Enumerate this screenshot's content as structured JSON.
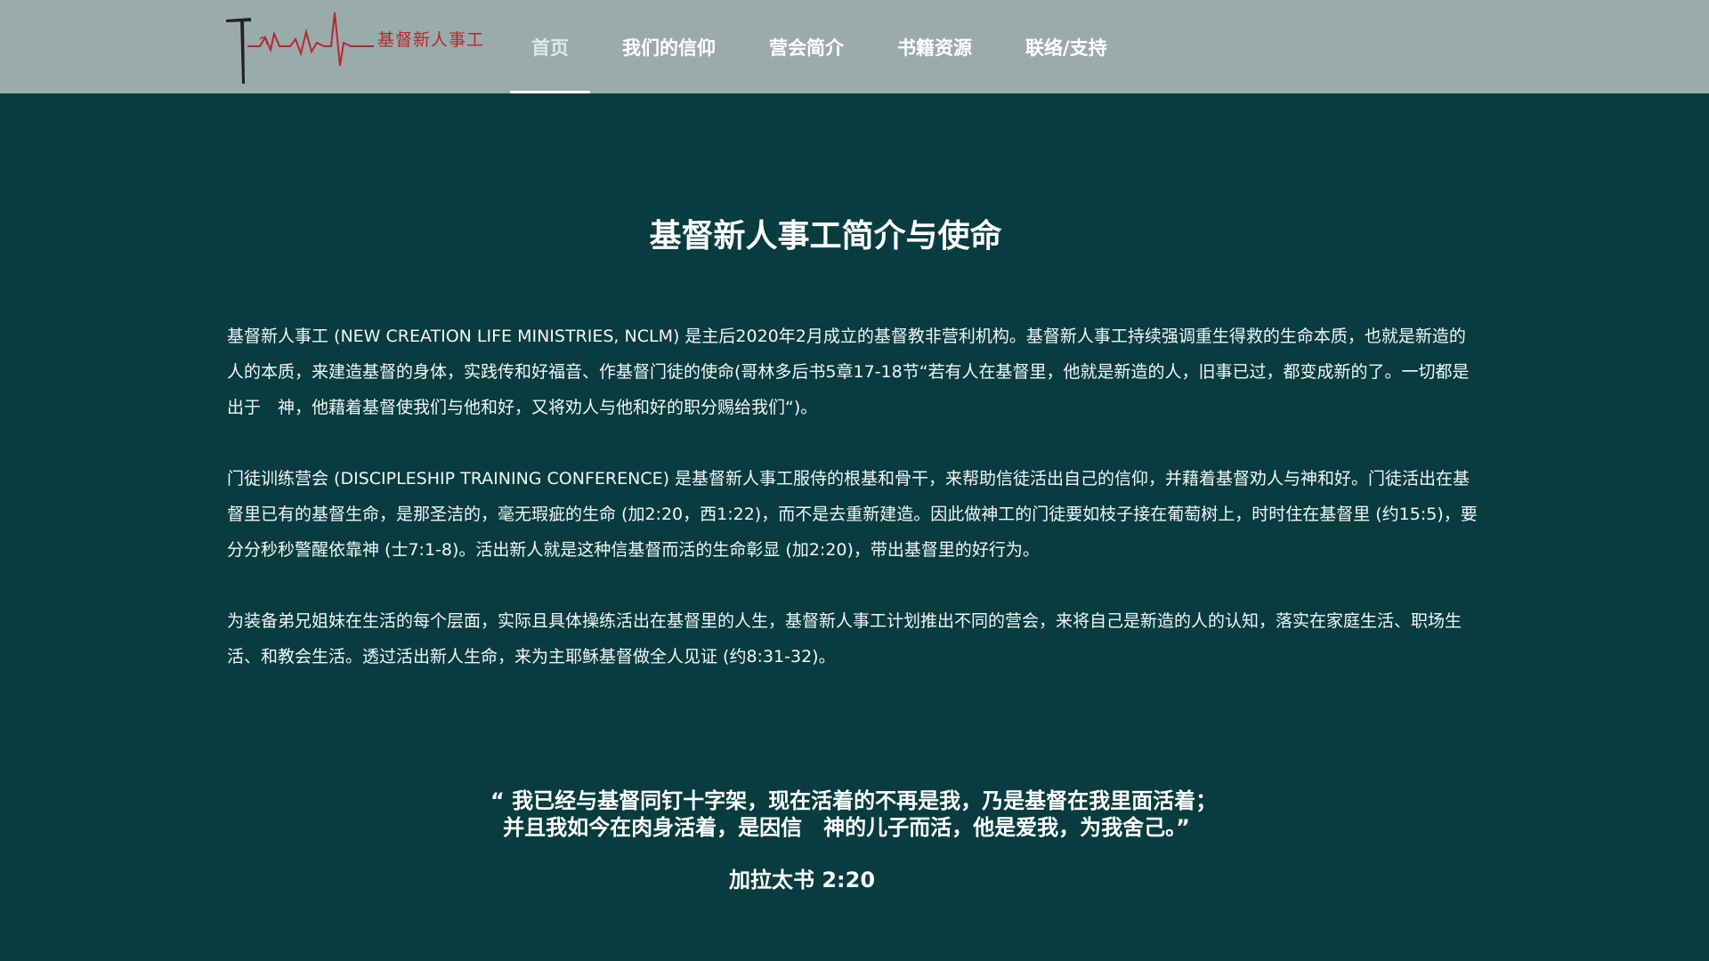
{
  "header": {
    "logo_text": "基督新人事工",
    "nav": [
      {
        "label": "首页",
        "active": true
      },
      {
        "label": "我们的信仰"
      },
      {
        "label": "营会简介"
      },
      {
        "label": "书籍资源"
      },
      {
        "label": "联络/支持"
      }
    ]
  },
  "main": {
    "title": "基督新人事工简介与使命",
    "paragraphs": [
      "基督新人事工 (NEW CREATION LIFE MINISTRIES, NCLM) 是主后2020年2月成立的基督教非营利机构。基督新人事工持续强调重生得救的生命本质，也就是新造的人的本质，来建造基督的身体，实践传和好福音、作基督门徒的使命(哥林多后书5章17-18节“若有人在基督里，他就是新造的人，旧事已过，都变成新的了。一切都是出于　神，他藉着基督使我们与他和好，又将劝人与他和好的职分赐给我们“)。",
      "门徒训练营会 (DISCIPLESHIP TRAINING CONFERENCE) 是基督新人事工服侍的根基和骨干，来帮助信徒活出自己的信仰，并藉着基督劝人与神和好。门徒活出在基督里已有的基督生命，是那圣洁的，毫无瑕疵的生命 (加2:20，西1:22)，而不是去重新建造。因此做神工的门徒要如枝子接在葡萄树上，时时住在基督里 (约15:5)，要分分秒秒警醒依靠神 (士7:1-8)。活出新人就是这种信基督而活的生命彰显 (加2:20)，带出基督里的好行为。",
      "为装备弟兄姐妹在生活的每个层面，实际且具体操练活出在基督里的人生，基督新人事工计划推出不同的营会，来将自己是新造的人的认知，落实在家庭生活、职场生活、和教会生活。透过活出新人生命，来为主耶稣基督做全人见证 (约8:31-32)。"
    ],
    "quote_line1": "“ 我已经与基督同钉十字架，现在活着的不再是我，乃是基督在我里面活着；",
    "quote_line2": "并且我如今在肉身活着，是因信　神的儿子而活，他是爱我，为我舍己。”",
    "quote_ref": "加拉太书 2:20"
  },
  "colors": {
    "header_bg": "#9aabab",
    "page_bg": "#083c3f",
    "logo_red": "#b7282e"
  }
}
